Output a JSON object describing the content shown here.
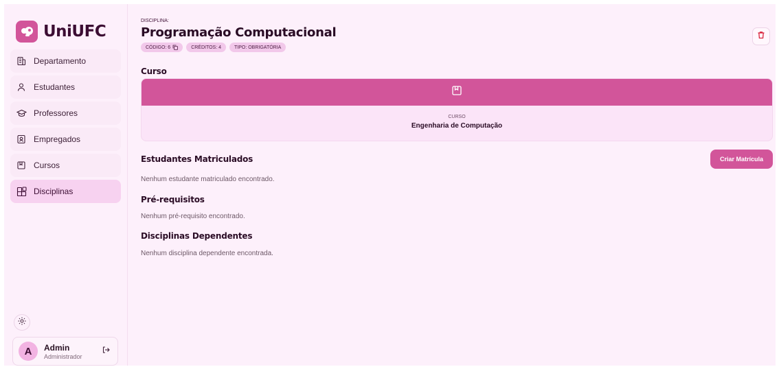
{
  "brand": {
    "name": "UniUFC"
  },
  "sidebar": {
    "items": [
      {
        "label": "Departamento",
        "icon": "building-icon"
      },
      {
        "label": "Estudantes",
        "icon": "user-icon"
      },
      {
        "label": "Professores",
        "icon": "graduation-cap-icon"
      },
      {
        "label": "Empregados",
        "icon": "id-badge-icon"
      },
      {
        "label": "Cursos",
        "icon": "book-icon"
      },
      {
        "label": "Disciplinas",
        "icon": "grid-icon",
        "active": true
      }
    ]
  },
  "user": {
    "initial": "A",
    "name": "Admin",
    "role": "Administrador"
  },
  "page": {
    "eyebrow": "DISCIPLINA:",
    "title": "Programação Computacional",
    "badges": {
      "codigo": "CÓDIGO: 6",
      "creditos": "CRÉDITOS: 4",
      "tipo": "TIPO: OBRIGATÓRIA"
    }
  },
  "curso": {
    "heading": "Curso",
    "label": "CURSO",
    "name": "Engenharia de Computação"
  },
  "estudantes": {
    "heading": "Estudantes Matriculados",
    "empty": "Nenhum estudante matriculado encontrado.",
    "create_label": "Criar Matrícula"
  },
  "prerequisitos": {
    "heading": "Pré-requisitos",
    "empty": "Nenhum pré-requisito encontrado."
  },
  "dependentes": {
    "heading": "Disciplinas Dependentes",
    "empty": "Nenhum disciplina dependente encontrada."
  },
  "colors": {
    "accent": "#d2559a",
    "background": "#fdf0fb",
    "active_nav": "#f7d2f0",
    "delete": "#d8223a"
  }
}
